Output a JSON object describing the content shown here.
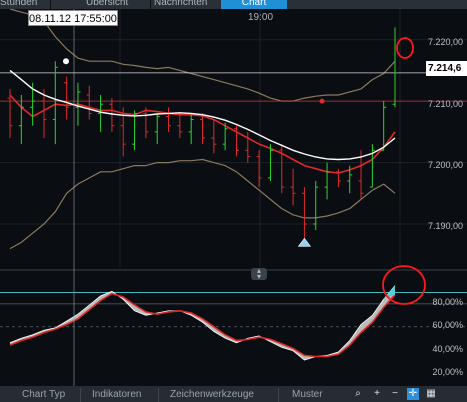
{
  "tabs": [
    {
      "label": "Stunden",
      "active": false
    },
    {
      "label": "Übersicht",
      "active": false
    },
    {
      "label": "Nachrichten",
      "active": false
    },
    {
      "label": "Chart",
      "active": true
    }
  ],
  "crosshair": {
    "date_label": "08.11.12 17:55:00",
    "time_label": "19:00",
    "price_label": "7.214,6"
  },
  "price_axis": {
    "ticks": [
      "7.220,00",
      "7.210,00",
      "7.200,00",
      "7.190,00"
    ]
  },
  "oscillator_axis": {
    "ticks": [
      "80,00%",
      "60,00%",
      "40,00%",
      "20,00%"
    ]
  },
  "bottom_toolbar": {
    "items": [
      "Chart Typ",
      "Indikatoren",
      "Zeichenwerkzeuge",
      "Muster"
    ],
    "icons": [
      "magnifier-icon",
      "plus-icon",
      "minus-icon",
      "crosshair-icon",
      "grid-icon"
    ]
  },
  "colors": {
    "up": "#2fd42f",
    "down": "#e02a2a",
    "ma": "#ffffff",
    "band": "#8a7a5e",
    "mid_band": "#e02a2a",
    "stoch_fill": "#d9d9d9",
    "stoch_line": "#e02a2a",
    "accent": "#4fd1d9",
    "annotation": "#ff1a1a"
  },
  "chart_data": [
    {
      "type": "candlestick",
      "ylim": [
        7183,
        7225
      ],
      "candles": [
        {
          "o": 7210.5,
          "h": 7212.0,
          "l": 7204.0,
          "c": 7206.0
        },
        {
          "o": 7206.0,
          "h": 7211.0,
          "l": 7203.0,
          "c": 7209.0
        },
        {
          "o": 7209.0,
          "h": 7213.0,
          "l": 7206.0,
          "c": 7210.0
        },
        {
          "o": 7210.0,
          "h": 7212.0,
          "l": 7204.0,
          "c": 7207.0
        },
        {
          "o": 7207.0,
          "h": 7216.5,
          "l": 7203.0,
          "c": 7215.5
        },
        {
          "o": 7213.0,
          "h": 7214.0,
          "l": 7207.0,
          "c": 7209.0
        },
        {
          "o": 7209.0,
          "h": 7213.0,
          "l": 7206.0,
          "c": 7211.5
        },
        {
          "o": 7211.0,
          "h": 7212.5,
          "l": 7207.0,
          "c": 7208.0
        },
        {
          "o": 7208.0,
          "h": 7211.0,
          "l": 7205.0,
          "c": 7209.5
        },
        {
          "o": 7209.5,
          "h": 7210.5,
          "l": 7205.0,
          "c": 7206.0
        },
        {
          "o": 7206.0,
          "h": 7209.0,
          "l": 7201.0,
          "c": 7203.0
        },
        {
          "o": 7203.0,
          "h": 7208.5,
          "l": 7202.0,
          "c": 7208.0
        },
        {
          "o": 7208.0,
          "h": 7209.0,
          "l": 7204.0,
          "c": 7205.0
        },
        {
          "o": 7205.0,
          "h": 7208.0,
          "l": 7203.0,
          "c": 7207.5
        },
        {
          "o": 7207.5,
          "h": 7209.0,
          "l": 7205.0,
          "c": 7206.0
        },
        {
          "o": 7206.0,
          "h": 7208.0,
          "l": 7204.0,
          "c": 7205.0
        },
        {
          "o": 7205.0,
          "h": 7208.0,
          "l": 7203.0,
          "c": 7207.0
        },
        {
          "o": 7207.0,
          "h": 7208.0,
          "l": 7203.0,
          "c": 7204.0
        },
        {
          "o": 7204.0,
          "h": 7207.0,
          "l": 7201.5,
          "c": 7203.0
        },
        {
          "o": 7203.0,
          "h": 7206.5,
          "l": 7202.0,
          "c": 7205.5
        },
        {
          "o": 7205.5,
          "h": 7206.0,
          "l": 7201.0,
          "c": 7202.0
        },
        {
          "o": 7202.0,
          "h": 7205.0,
          "l": 7200.0,
          "c": 7201.0
        },
        {
          "o": 7201.0,
          "h": 7202.0,
          "l": 7196.0,
          "c": 7197.5
        },
        {
          "o": 7197.5,
          "h": 7203.0,
          "l": 7197.0,
          "c": 7202.0
        },
        {
          "o": 7202.0,
          "h": 7203.0,
          "l": 7195.0,
          "c": 7196.0
        },
        {
          "o": 7196.0,
          "h": 7199.0,
          "l": 7193.0,
          "c": 7195.0
        },
        {
          "o": 7195.0,
          "h": 7196.0,
          "l": 7187.5,
          "c": 7190.0
        },
        {
          "o": 7190.0,
          "h": 7197.0,
          "l": 7189.0,
          "c": 7196.0
        },
        {
          "o": 7196.0,
          "h": 7200.0,
          "l": 7194.0,
          "c": 7198.5
        },
        {
          "o": 7198.5,
          "h": 7199.0,
          "l": 7196.0,
          "c": 7197.0
        },
        {
          "o": 7197.0,
          "h": 7199.5,
          "l": 7195.0,
          "c": 7198.0
        },
        {
          "o": 7197.0,
          "h": 7202.0,
          "l": 7194.0,
          "c": 7195.0
        },
        {
          "o": 7196.0,
          "h": 7203.0,
          "l": 7196.0,
          "c": 7202.0
        },
        {
          "o": 7202.0,
          "h": 7210.0,
          "l": 7202.0,
          "c": 7209.0
        },
        {
          "o": 7209.5,
          "h": 7222.0,
          "l": 7209.0,
          "c": 7214.6
        }
      ],
      "moving_average": [
        7215.0,
        7213.5,
        7212.0,
        7211.0,
        7210.3,
        7209.8,
        7209.2,
        7208.7,
        7208.2,
        7207.9,
        7207.7,
        7207.6,
        7207.7,
        7207.9,
        7208.0,
        7208.1,
        7208.0,
        7207.8,
        7207.4,
        7206.9,
        7206.2,
        7205.4,
        7204.5,
        7203.6,
        7202.8,
        7202.0,
        7201.4,
        7200.9,
        7200.6,
        7200.5,
        7200.6,
        7200.9,
        7201.5,
        7202.5,
        7204.0
      ],
      "upper_band": [
        7225.0,
        7224.5,
        7224.0,
        7223.0,
        7220.5,
        7218.5,
        7217.0,
        7216.5,
        7216.5,
        7216.5,
        7216.0,
        7215.8,
        7215.5,
        7215.3,
        7215.5,
        7215.0,
        7214.5,
        7214.0,
        7213.5,
        7213.0,
        7212.5,
        7212.0,
        7211.3,
        7210.5,
        7210.0,
        7210.0,
        7210.5,
        7210.8,
        7211.0,
        7211.0,
        7211.5,
        7212.0,
        7213.5,
        7214.5,
        7216.5
      ],
      "middle_band": [
        7211.0,
        7209.0,
        7207.5,
        7208.5,
        7209.5,
        7209.3,
        7209.5,
        7209.0,
        7208.5,
        7208.5,
        7208.0,
        7207.8,
        7208.5,
        7208.3,
        7208.0,
        7207.8,
        7207.8,
        7207.6,
        7207.0,
        7206.0,
        7205.0,
        7204.0,
        7203.0,
        7202.3,
        7201.5,
        7200.5,
        7199.5,
        7199.0,
        7198.5,
        7198.3,
        7198.8,
        7199.5,
        7200.5,
        7202.5,
        7205.0
      ],
      "lower_band": [
        7186.0,
        7187.0,
        7188.5,
        7190.0,
        7192.0,
        7195.0,
        7196.5,
        7197.5,
        7198.5,
        7198.5,
        7199.0,
        7199.5,
        7199.5,
        7200.0,
        7200.0,
        7200.3,
        7200.3,
        7200.5,
        7200.0,
        7199.5,
        7198.5,
        7197.0,
        7195.5,
        7194.0,
        7192.5,
        7191.5,
        7191.0,
        7191.0,
        7191.3,
        7191.8,
        7192.5,
        7194.0,
        7195.5,
        7196.5,
        7195.0
      ],
      "horizontal_lines": [
        {
          "y": 7214.6,
          "color": "white"
        },
        {
          "y": 7210.0,
          "color": "red"
        }
      ]
    },
    {
      "type": "line",
      "ylim": [
        10,
        100
      ],
      "fast": [
        46,
        50,
        53,
        57,
        59,
        65,
        71,
        79,
        87,
        91,
        84,
        74,
        70,
        72,
        74,
        74,
        70,
        64,
        56,
        50,
        46,
        50,
        52,
        47,
        42,
        39,
        31,
        34,
        35,
        38,
        48,
        62,
        70,
        84,
        96
      ],
      "slow": [
        44,
        48,
        51,
        55,
        58,
        62,
        67,
        75,
        83,
        89,
        86,
        79,
        73,
        71,
        73,
        74,
        72,
        67,
        60,
        53,
        48,
        49,
        51,
        49,
        45,
        41,
        35,
        34,
        34,
        36,
        44,
        55,
        64,
        77,
        88
      ],
      "levels": [
        90,
        80,
        60
      ]
    }
  ]
}
